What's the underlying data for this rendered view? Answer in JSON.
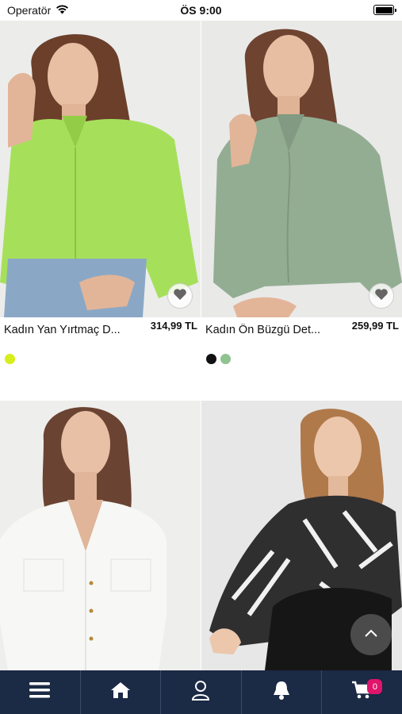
{
  "status_bar": {
    "carrier": "Operatör",
    "time": "ÖS 9:00",
    "icons": [
      "wifi-icon",
      "battery-icon"
    ]
  },
  "products": [
    {
      "name": "Kadın Yan Yırtmaç D...",
      "price": "314,99 TL",
      "swatches": [
        "#d6ee1a"
      ],
      "favorite_icon": "heart-icon"
    },
    {
      "name": "Kadın Ön Büzgü Det...",
      "price": "259,99 TL",
      "swatches": [
        "#111111",
        "#8fc38f"
      ],
      "favorite_icon": "heart-icon"
    },
    {
      "name": "",
      "price": "",
      "swatches": []
    },
    {
      "name": "",
      "price": "",
      "swatches": []
    }
  ],
  "scroll_top": {
    "icon": "chevron-up-icon"
  },
  "bottom_nav": {
    "items": [
      {
        "icon": "menu-icon"
      },
      {
        "icon": "home-icon"
      },
      {
        "icon": "user-icon"
      },
      {
        "icon": "bell-icon"
      },
      {
        "icon": "cart-icon",
        "badge": "0"
      }
    ],
    "background": "#1b2a45",
    "badge_color": "#e0146b"
  }
}
